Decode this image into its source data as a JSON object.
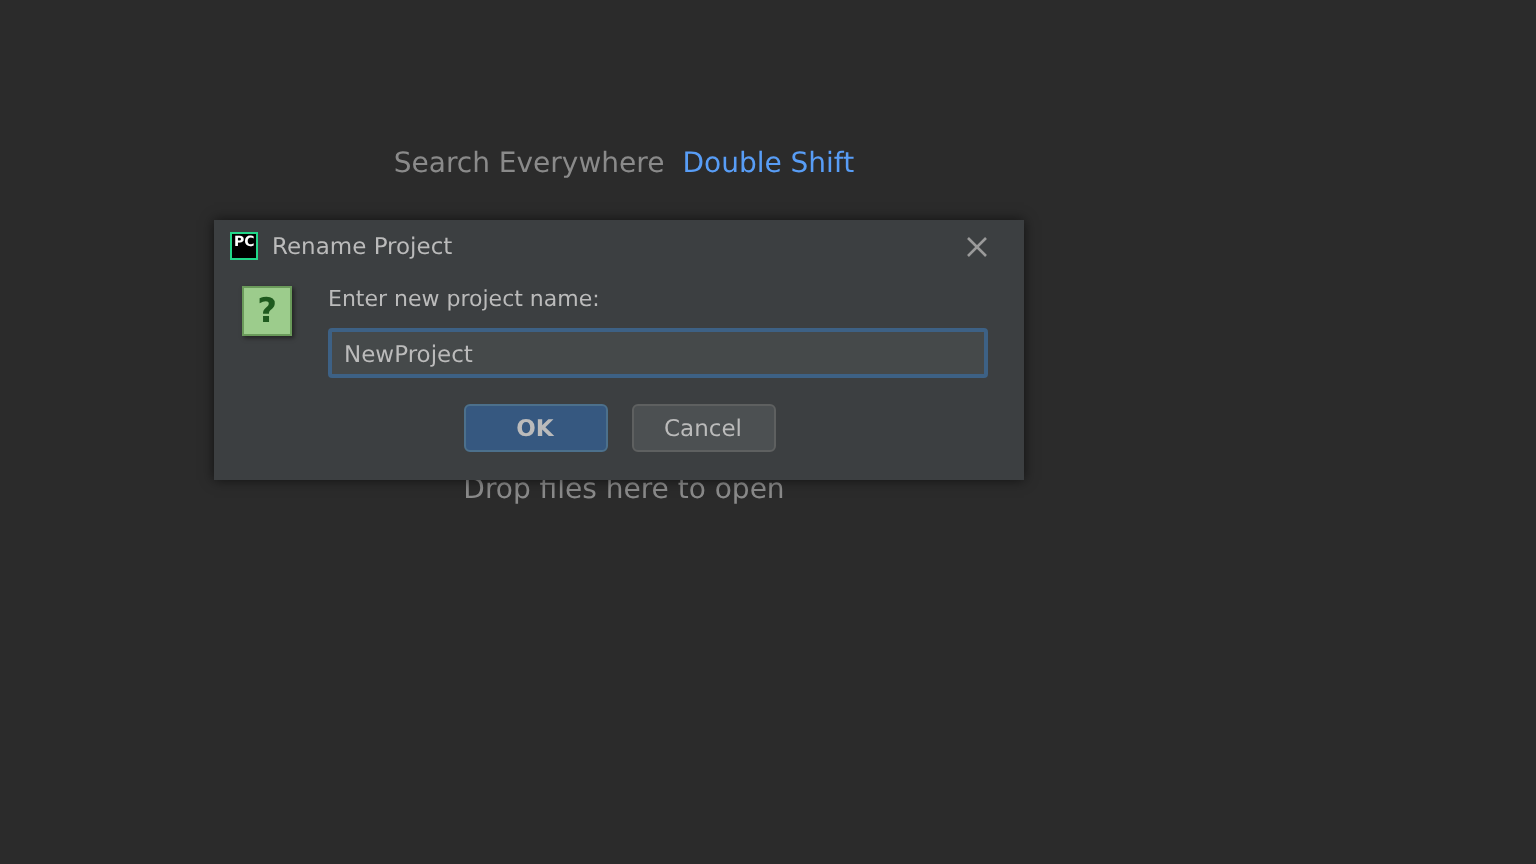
{
  "hints": [
    {
      "label": "Search Everywhere",
      "shortcut": "Double Shift"
    },
    {
      "label": "Drop files here to open"
    }
  ],
  "dialog": {
    "logo": "PC",
    "title": "Rename Project",
    "question_mark": "?",
    "prompt": "Enter new project name:",
    "field": {
      "value": "NewProject",
      "focused": true
    },
    "buttons": [
      {
        "label": "OK",
        "default": true
      },
      {
        "label": "Cancel",
        "default": false
      }
    ]
  }
}
